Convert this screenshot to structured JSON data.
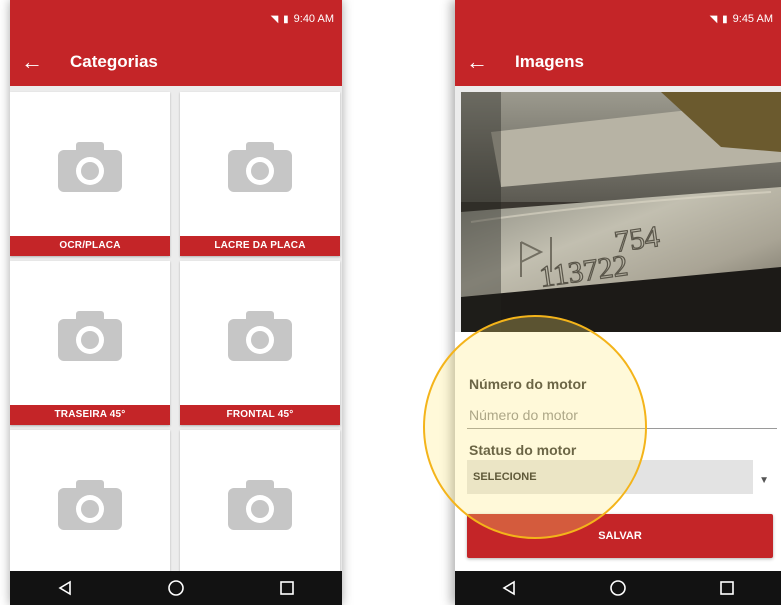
{
  "left_screen": {
    "status": {
      "time": "9:40 AM"
    },
    "app_bar": {
      "back_icon": "arrow-back-icon",
      "title": "Categorias"
    },
    "categories": [
      {
        "label": "OCR/PLACA",
        "icon": "camera-icon"
      },
      {
        "label": "LACRE DA PLACA",
        "icon": "camera-icon"
      },
      {
        "label": "TRASEIRA 45°",
        "icon": "camera-icon"
      },
      {
        "label": "FRONTAL 45°",
        "icon": "camera-icon"
      },
      {
        "label": "",
        "icon": "camera-icon"
      },
      {
        "label": "",
        "icon": "camera-icon"
      }
    ],
    "nav": [
      "back-triangle-icon",
      "home-circle-icon",
      "recents-square-icon"
    ]
  },
  "right_screen": {
    "status": {
      "time": "9:45 AM"
    },
    "app_bar": {
      "back_icon": "arrow-back-icon",
      "title": "Imagens"
    },
    "photo": {
      "engraved_text_line1": "754",
      "engraved_text_line2": "113722"
    },
    "form": {
      "motor_number_label": "Número do motor",
      "motor_number_value": "",
      "motor_number_placeholder": "Número do motor",
      "motor_status_label": "Status do motor",
      "motor_status_selected": "SELECIONE",
      "save_label": "SALVAR"
    },
    "nav": [
      "back-triangle-icon",
      "home-circle-icon",
      "recents-square-icon"
    ]
  },
  "colors": {
    "accent": "#c42528",
    "highlight_ring": "#f4b41a",
    "card_bg": "#ffffff",
    "icon_gray": "#c6c6c6"
  }
}
